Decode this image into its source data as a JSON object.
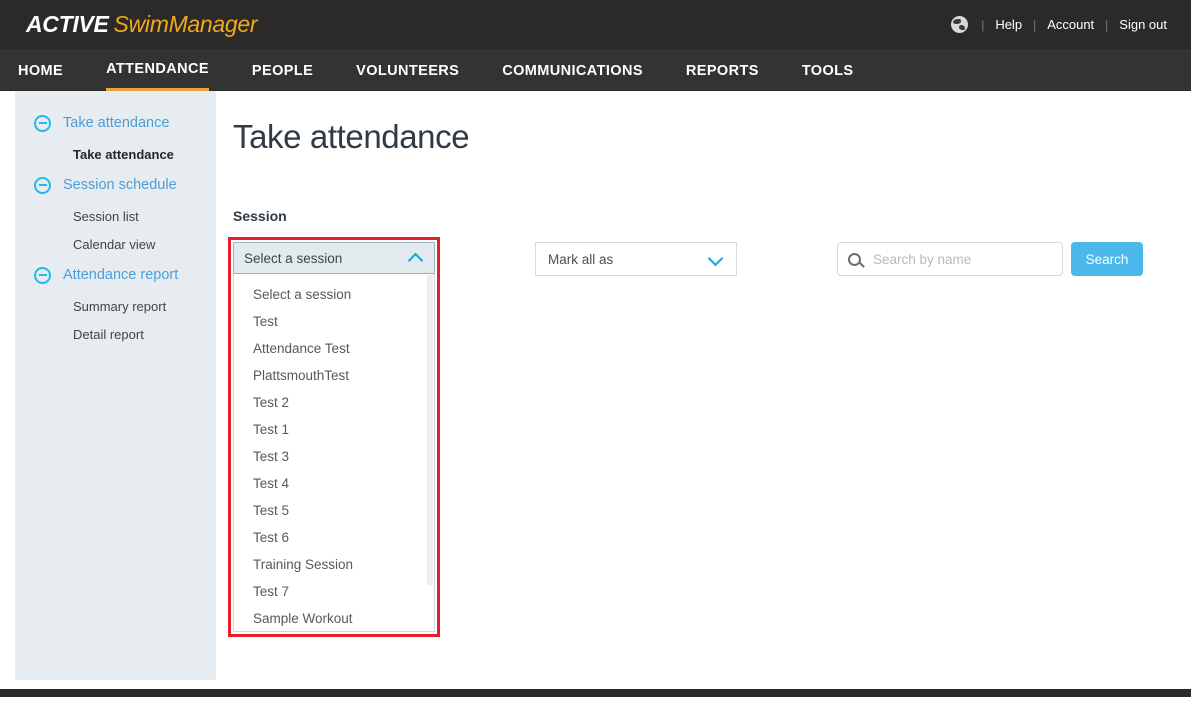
{
  "brand": {
    "active_word": "ACTIVE",
    "product_word": "SwimManager"
  },
  "header": {
    "globe_icon": "globe-icon",
    "separator": "|",
    "links": [
      {
        "label": "Help"
      },
      {
        "label": "Account"
      },
      {
        "label": "Sign out"
      }
    ]
  },
  "nav": {
    "items": [
      {
        "label": "HOME",
        "active": false
      },
      {
        "label": "ATTENDANCE",
        "active": true
      },
      {
        "label": "PEOPLE",
        "active": false
      },
      {
        "label": "VOLUNTEERS",
        "active": false
      },
      {
        "label": "COMMUNICATIONS",
        "active": false
      },
      {
        "label": "REPORTS",
        "active": false
      },
      {
        "label": "TOOLS",
        "active": false
      }
    ],
    "active_underline_color": "#e8a33d"
  },
  "sidebar": {
    "groups": [
      {
        "label": "Take attendance",
        "icon": "circle-minus-icon",
        "children": [
          {
            "label": "Take attendance",
            "current": true
          }
        ]
      },
      {
        "label": "Session schedule",
        "icon": "circle-minus-icon",
        "children": [
          {
            "label": "Session list",
            "current": false
          },
          {
            "label": "Calendar view",
            "current": false
          }
        ]
      },
      {
        "label": "Attendance report",
        "icon": "circle-minus-icon",
        "children": [
          {
            "label": "Summary report",
            "current": false
          },
          {
            "label": "Detail report",
            "current": false
          }
        ]
      }
    ]
  },
  "main": {
    "page_title": "Take attendance",
    "section_label": "Session",
    "session_select": {
      "selected_label": "Select a session",
      "expanded": true,
      "caret_icon": "chevron-up-icon",
      "highlight_color": "#e61e2a",
      "options": [
        "Select a session",
        "Test",
        "Attendance Test",
        "PlattsmouthTest",
        "Test 2",
        "Test 1",
        "Test 3",
        "Test 4",
        "Test 5",
        "Test 6",
        "Training Session",
        "Test 7",
        "Sample Workout"
      ]
    },
    "mark_all": {
      "selected_label": "Mark all as",
      "caret_icon": "chevron-down-icon"
    },
    "search": {
      "icon": "search-icon",
      "value": "",
      "placeholder": "Search by name",
      "button_label": "Search",
      "button_color": "#4ab8ea"
    }
  }
}
